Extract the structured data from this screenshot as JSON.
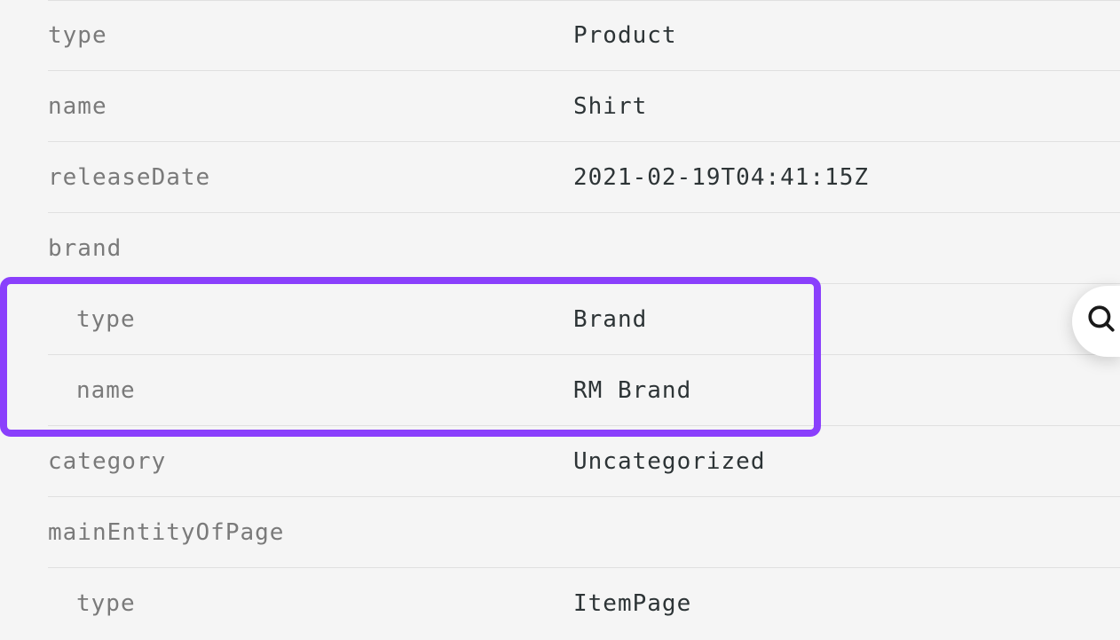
{
  "rows": {
    "type": {
      "key": "type",
      "value": "Product"
    },
    "name": {
      "key": "name",
      "value": "Shirt"
    },
    "releaseDate": {
      "key": "releaseDate",
      "value": "2021-02-19T04:41:15Z"
    },
    "brand": {
      "key": "brand"
    },
    "brandType": {
      "key": "type",
      "value": "Brand"
    },
    "brandName": {
      "key": "name",
      "value": "RM Brand"
    },
    "category": {
      "key": "category",
      "value": "Uncategorized"
    },
    "mainEntityOfPage": {
      "key": "mainEntityOfPage"
    },
    "mainEntityType": {
      "key": "type",
      "value": "ItemPage"
    }
  }
}
